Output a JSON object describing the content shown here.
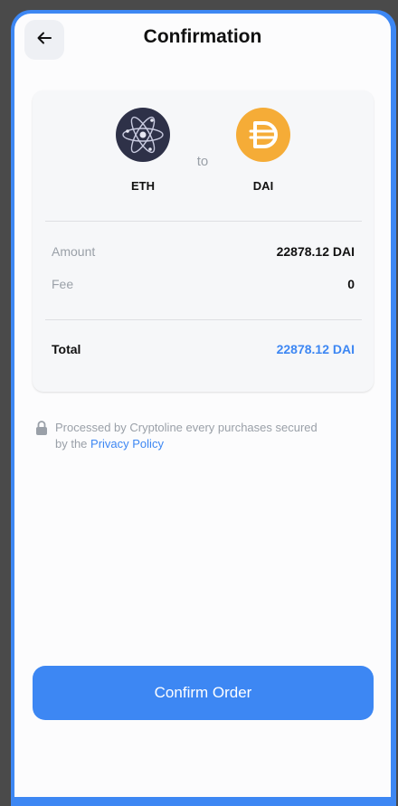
{
  "header": {
    "title": "Confirmation",
    "back_icon": "arrow-left-icon"
  },
  "swap": {
    "from": {
      "symbol": "ETH",
      "icon": "atom-coin-icon",
      "color": "#2e3148"
    },
    "separator": "to",
    "to": {
      "symbol": "DAI",
      "icon": "dai-coin-icon",
      "color": "#f5ac37"
    }
  },
  "details": {
    "amount_label": "Amount",
    "amount_value": "22878.12 DAI",
    "fee_label": "Fee",
    "fee_value": "0",
    "total_label": "Total",
    "total_value": "22878.12 DAI"
  },
  "notice": {
    "text": "Processed by Cryptoline every purchases secured by the ",
    "link": "Privacy Policy",
    "icon": "lock-icon"
  },
  "confirm_button": "Confirm Order",
  "colors": {
    "accent": "#3d87f3",
    "muted": "#9aa0a8"
  }
}
